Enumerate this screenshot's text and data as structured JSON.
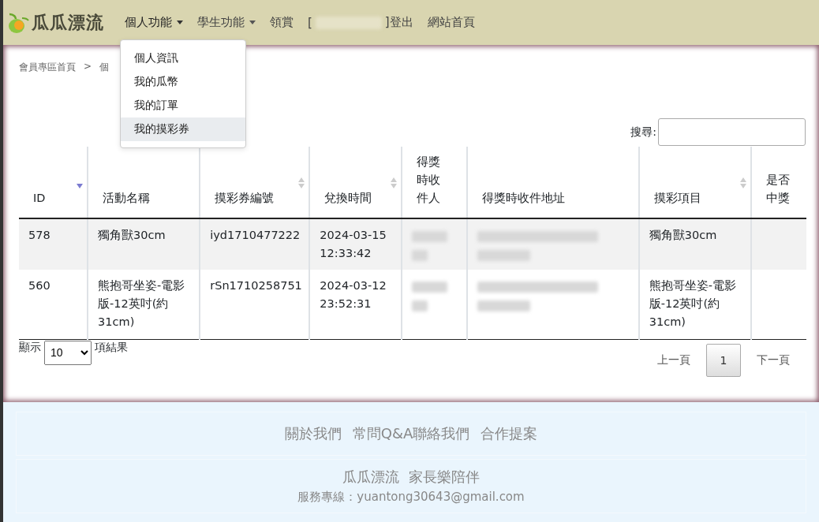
{
  "navbar": {
    "brand": "瓜瓜漂流",
    "items": [
      {
        "kind": "dropdown",
        "label": "個人功能",
        "expanded": true
      },
      {
        "kind": "dropdown",
        "label": "學生功能",
        "expanded": false
      },
      {
        "kind": "link",
        "label": "領賞"
      },
      {
        "kind": "user",
        "prefix": "[",
        "suffix": "]登出"
      },
      {
        "kind": "link",
        "label": "網站首頁"
      }
    ]
  },
  "dropdown_menu": {
    "items": [
      {
        "label": "個人資訊",
        "selected": false
      },
      {
        "label": "我的瓜幣",
        "selected": false
      },
      {
        "label": "我的訂單",
        "selected": false
      },
      {
        "label": "我的摸彩券",
        "selected": true
      }
    ]
  },
  "breadcrumb": {
    "items": [
      "會員專區首頁",
      "個"
    ],
    "separator": ">"
  },
  "search": {
    "label": "搜尋:"
  },
  "table": {
    "columns": [
      {
        "label": "ID",
        "kind": "sorted"
      },
      {
        "label": "活動名稱",
        "kind": "plain"
      },
      {
        "label": "摸彩券編號",
        "kind": "sortable"
      },
      {
        "label": "兌換時間",
        "kind": "sortable"
      },
      {
        "label": "得獎時收件人",
        "kind": "plain"
      },
      {
        "label": "得獎時收件地址",
        "kind": "plain"
      },
      {
        "label": "摸彩項目",
        "kind": "sortable"
      },
      {
        "label": "是否中獎",
        "kind": "plain"
      }
    ],
    "rows": [
      {
        "cells": [
          {
            "kind": "text",
            "text": "578"
          },
          {
            "kind": "text",
            "text": "獨角獸30cm"
          },
          {
            "kind": "text",
            "text": "iyd1710477222"
          },
          {
            "kind": "text",
            "text": "2024-03-15 12:33:42"
          },
          {
            "kind": "redacted"
          },
          {
            "kind": "redacted"
          },
          {
            "kind": "text",
            "text": "獨角獸30cm"
          },
          {
            "kind": "empty"
          }
        ]
      },
      {
        "cells": [
          {
            "kind": "text",
            "text": "560"
          },
          {
            "kind": "text",
            "text": "熊抱哥坐姿-電影版-12英吋(約31cm)"
          },
          {
            "kind": "text",
            "text": "rSn1710258751"
          },
          {
            "kind": "text",
            "text": "2024-03-12 23:52:31"
          },
          {
            "kind": "redacted"
          },
          {
            "kind": "redacted"
          },
          {
            "kind": "text",
            "text": "熊抱哥坐姿-電影版-12英吋(約31cm)"
          },
          {
            "kind": "empty"
          }
        ]
      }
    ]
  },
  "length_menu": {
    "prefix": "顯示",
    "value": "10",
    "suffix": "項結果"
  },
  "pagination": {
    "previous": "上一頁",
    "pages": [
      {
        "label": "1",
        "selected": true
      }
    ],
    "next": "下一頁"
  },
  "footer": {
    "links": [
      "關於我們",
      "常問Q&A聯絡我們",
      "合作提案"
    ],
    "slogan": "瓜瓜漂流  家長樂陪伴",
    "contact": "服務專線：yuantong30643@gmail.com"
  }
}
